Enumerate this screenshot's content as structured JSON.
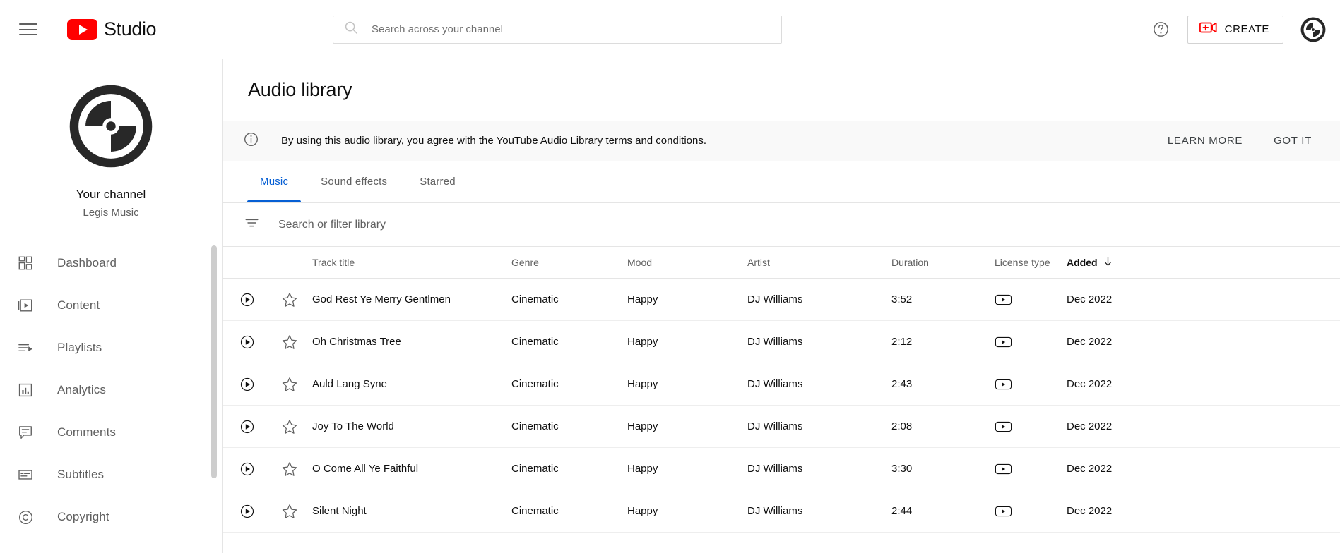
{
  "topbar": {
    "menu_icon": "hamburger-icon",
    "brand": "Studio",
    "brand_logo_icon": "youtube-logo-icon",
    "search": {
      "placeholder": "Search across your channel",
      "value": "",
      "icon": "search-icon"
    },
    "help_icon": "help-circle-icon",
    "create_label": "CREATE",
    "create_icon": "video-plus-icon",
    "avatar_icon": "channel-avatar-icon"
  },
  "sidebar": {
    "channel_label": "Your channel",
    "channel_name": "Legis Music",
    "avatar_icon": "channel-avatar-icon",
    "items": [
      {
        "label": "Dashboard",
        "icon": "dashboard-grid-icon"
      },
      {
        "label": "Content",
        "icon": "video-frame-icon"
      },
      {
        "label": "Playlists",
        "icon": "playlist-icon"
      },
      {
        "label": "Analytics",
        "icon": "bar-chart-icon"
      },
      {
        "label": "Comments",
        "icon": "comment-bubble-icon"
      },
      {
        "label": "Subtitles",
        "icon": "subtitles-icon"
      },
      {
        "label": "Copyright",
        "icon": "copyright-icon"
      }
    ]
  },
  "main": {
    "page_title": "Audio library",
    "notice": {
      "icon": "info-circle-icon",
      "text": "By using this audio library, you agree with the YouTube Audio Library terms and conditions.",
      "learn_more": "LEARN MORE",
      "got_it": "GOT IT"
    },
    "tabs": [
      {
        "label": "Music",
        "active": true
      },
      {
        "label": "Sound effects",
        "active": false
      },
      {
        "label": "Starred",
        "active": false
      }
    ],
    "filter": {
      "icon": "filter-icon",
      "placeholder": "Search or filter library",
      "value": ""
    },
    "table": {
      "columns": [
        "Track title",
        "Genre",
        "Mood",
        "Artist",
        "Duration",
        "License type",
        "Added"
      ],
      "sort_column": "Added",
      "sort_icon": "arrow-down-icon",
      "play_icon": "play-circle-icon",
      "star_icon": "star-outline-icon",
      "license_icon": "youtube-outline-icon",
      "rows": [
        {
          "title": "God Rest Ye Merry Gentlmen",
          "genre": "Cinematic",
          "mood": "Happy",
          "artist": "DJ Williams",
          "duration": "3:52",
          "added": "Dec 2022"
        },
        {
          "title": "Oh Christmas Tree",
          "genre": "Cinematic",
          "mood": "Happy",
          "artist": "DJ Williams",
          "duration": "2:12",
          "added": "Dec 2022"
        },
        {
          "title": "Auld Lang Syne",
          "genre": "Cinematic",
          "mood": "Happy",
          "artist": "DJ Williams",
          "duration": "2:43",
          "added": "Dec 2022"
        },
        {
          "title": "Joy To The World",
          "genre": "Cinematic",
          "mood": "Happy",
          "artist": "DJ Williams",
          "duration": "2:08",
          "added": "Dec 2022"
        },
        {
          "title": "O Come All Ye Faithful",
          "genre": "Cinematic",
          "mood": "Happy",
          "artist": "DJ Williams",
          "duration": "3:30",
          "added": "Dec 2022"
        },
        {
          "title": "Silent Night",
          "genre": "Cinematic",
          "mood": "Happy",
          "artist": "DJ Williams",
          "duration": "2:44",
          "added": "Dec 2022"
        }
      ]
    }
  },
  "colors": {
    "youtube_red": "#ff0000",
    "accent_blue": "#065fd4",
    "text_primary": "#0f0f0f",
    "text_secondary": "#606060",
    "banner_bg": "#f9f9f9",
    "border": "#e5e5e5"
  }
}
